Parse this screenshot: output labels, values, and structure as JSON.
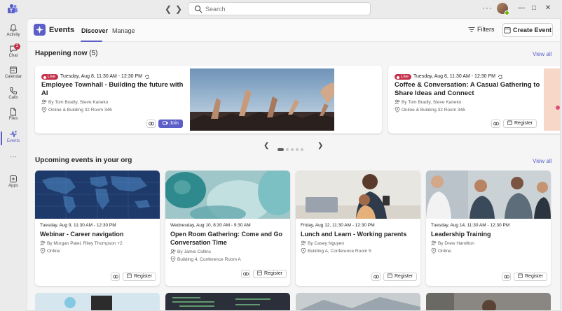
{
  "titlebar": {
    "search_placeholder": "Search",
    "more_label": "···"
  },
  "rail": {
    "items": [
      {
        "label": "Activity",
        "icon": "bell-icon"
      },
      {
        "label": "Chat",
        "icon": "chat-icon",
        "badge": "2"
      },
      {
        "label": "Calendar",
        "icon": "calendar-icon"
      },
      {
        "label": "Calls",
        "icon": "phone-icon"
      },
      {
        "label": "Files",
        "icon": "file-icon"
      },
      {
        "label": "Events",
        "icon": "events-icon"
      },
      {
        "label": "Apps",
        "icon": "plus-icon"
      }
    ],
    "more": "···"
  },
  "header": {
    "title": "Events",
    "tabs": [
      {
        "label": "Discover"
      },
      {
        "label": "Manage"
      }
    ],
    "filters_label": "Filters",
    "create_label": "Create Event"
  },
  "happening_now": {
    "title": "Happening now",
    "count": "(5)",
    "view_all": "View all",
    "live_label": "Live",
    "cards": [
      {
        "date": "Tuesday, Aug 8, 11:30 AM - 12:30 PM",
        "title": "Employee Townhall - Building the future with AI",
        "organizers": "By Tom Bradly, Steve Kaneko",
        "location": "Online & Building 32 Room 346",
        "action": "Join"
      },
      {
        "date": "Tuesday, Aug 8, 11:30 AM - 12:30 PM",
        "title": "Coffee & Conversation: A Casual Gathering to Share Ideas and Connect",
        "organizers": "By Tom Bradly, Steve Kaneko",
        "location": "Online & Building 32 Room 346",
        "action": "Register"
      }
    ]
  },
  "upcoming": {
    "title": "Upcoming events in your org",
    "view_all": "View all",
    "cards": [
      {
        "date": "Tuesday, Aug 9, 11:30 AM - 12:30 PM",
        "title": "Webinar - Career navigation",
        "organizers": "By Morgan Patel, Riley Thompson +2",
        "location": "Online",
        "action": "Register"
      },
      {
        "date": "Wednesday, Aug 10, 8:30 AM - 9:30 AM",
        "title": "Open Room Gathering: Come and Go Conversation Time",
        "organizers": "By Jamie Collins",
        "location": "Building 4, Conference Room A",
        "action": "Register"
      },
      {
        "date": "Friday, Aug 12, 11:30 AM - 12:30 PM",
        "title": "Lunch and Learn - Working parents",
        "organizers": "By Casey Nguyen",
        "location": "Building A, Conference Room 5",
        "action": "Register"
      },
      {
        "date": "Tuesday, Aug 14, 11:30 AM - 12:30 PM",
        "title": "Leadership Training",
        "organizers": "By Drew Hamilton",
        "location": "Online",
        "action": "Register"
      }
    ]
  },
  "colors": {
    "accent": "#5b5fc7",
    "live": "#c4314b"
  }
}
